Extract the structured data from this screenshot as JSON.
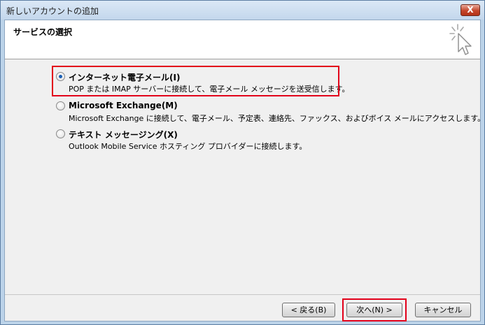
{
  "window": {
    "title": "新しいアカウントの追加",
    "close_glyph": "X"
  },
  "header": {
    "title": "サービスの選択",
    "icon": "wizard-cursor-icon"
  },
  "options": [
    {
      "label": "インターネット電子メール(I)",
      "description": "POP または IMAP サーバーに接続して、電子メール メッセージを送受信します。",
      "selected": true
    },
    {
      "label": "Microsoft Exchange(M)",
      "description": "Microsoft Exchange に接続して、電子メール、予定表、連絡先、ファックス、およびボイス メールにアクセスします。",
      "selected": false
    },
    {
      "label": "テキスト メッセージング(X)",
      "description": "Outlook Mobile Service ホスティング プロバイダーに接続します。",
      "selected": false
    }
  ],
  "buttons": {
    "back": "< 戻る(B)",
    "next": "次へ(N) >",
    "cancel": "キャンセル"
  },
  "colors": {
    "highlight": "#e2001a",
    "radio_selected": "#1a5fb4"
  }
}
